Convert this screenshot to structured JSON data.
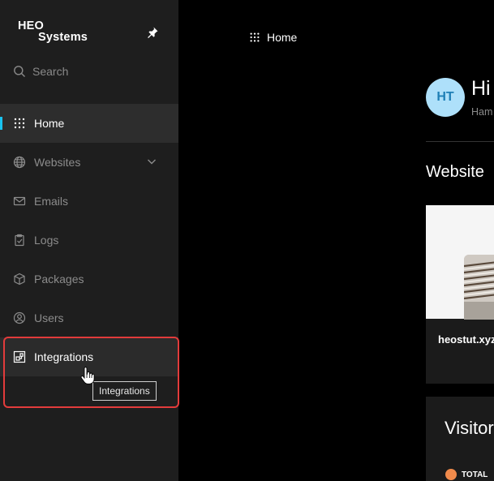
{
  "sidebar": {
    "logo": {
      "line1": "HEO",
      "line2": "Systems"
    },
    "search_label": "Search",
    "items": [
      {
        "label": "Home",
        "icon": "grid-icon",
        "state": "active"
      },
      {
        "label": "Websites",
        "icon": "globe-icon",
        "expandable": true
      },
      {
        "label": "Emails",
        "icon": "mail-icon"
      },
      {
        "label": "Logs",
        "icon": "clipboard-icon"
      },
      {
        "label": "Packages",
        "icon": "package-icon"
      },
      {
        "label": "Users",
        "icon": "user-icon"
      },
      {
        "label": "Integrations",
        "icon": "integrations-icon",
        "state": "hover"
      }
    ],
    "tooltip": "Integrations"
  },
  "main": {
    "breadcrumb": "Home",
    "avatar_initials": "HT",
    "greeting": "Hi",
    "greeting_sub": "Ham",
    "section_title": "Website",
    "site_card": {
      "name": "heostut.xyz"
    },
    "visitors": {
      "title": "Visitor",
      "legend_label": "TOTAL",
      "legend_color": "#f08a4b"
    }
  },
  "colors": {
    "sidebar_bg": "#1e1e1e",
    "accent": "#19c3f0",
    "highlight_border": "#e23b3b",
    "avatar_bg": "#aee0fa"
  }
}
